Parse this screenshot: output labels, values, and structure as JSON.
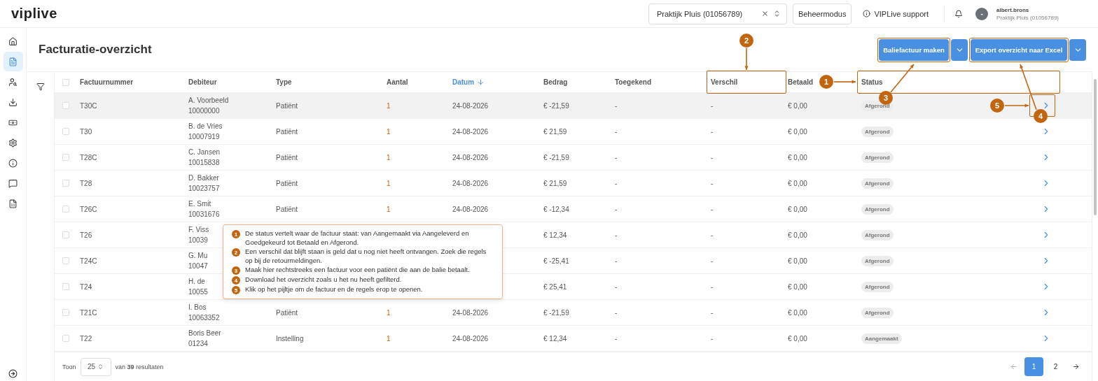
{
  "app": {
    "logo": "viplive"
  },
  "top_bar": {
    "practice_select": {
      "value": "Praktijk Pluis (01056789)"
    },
    "mode_button": "Beheermodus",
    "support_link": "VIPLive support",
    "user": {
      "avatar": "-",
      "name": "albert.brons",
      "practice": "Praktijk Pluis (01056789)"
    }
  },
  "sidebar": {
    "items": [
      {
        "selected": false
      },
      {
        "selected": true
      },
      {
        "selected": false
      },
      {
        "selected": false
      },
      {
        "selected": false
      },
      {
        "selected": false
      },
      {
        "selected": false
      },
      {
        "selected": false
      },
      {
        "selected": false
      }
    ]
  },
  "page": {
    "title": "Facturatie-overzicht",
    "buttons": [
      {
        "label": "Baliefactuur maken"
      },
      {
        "label": "Export overzicht naar Excel"
      }
    ]
  },
  "table": {
    "select_all_checked": false,
    "columns": [
      {
        "label": "Factuurnummer",
        "sorted": false
      },
      {
        "label": "Debiteur",
        "sorted": false
      },
      {
        "label": "Type",
        "sorted": false
      },
      {
        "label": "Aantal",
        "sorted": false
      },
      {
        "label": "Datum",
        "sorted": true
      },
      {
        "label": "Bedrag",
        "sorted": false
      },
      {
        "label": "Toegekend",
        "sorted": false
      },
      {
        "label": "Verschil",
        "sorted": false
      },
      {
        "label": "Betaald",
        "sorted": false
      },
      {
        "label": "Status",
        "sorted": false
      }
    ],
    "rows": [
      {
        "number": "T30C",
        "debtor": "A. Voorbeeld",
        "debtor_id": "10000000",
        "type": "Patiënt",
        "quantity": "1",
        "date": "24-08-2026",
        "amount": "€ -21,59",
        "granted": "-",
        "difference": "-",
        "paid": "€ 0,00",
        "status": "Afgerond",
        "checked": false,
        "hovered": true
      },
      {
        "number": "T30",
        "debtor": "B. de Vries",
        "debtor_id": "10007919",
        "type": "Patiënt",
        "quantity": "1",
        "date": "24-08-2026",
        "amount": "€ 21,59",
        "granted": "-",
        "difference": "-",
        "paid": "€ 0,00",
        "status": "Afgerond",
        "checked": false,
        "hovered": false
      },
      {
        "number": "T28C",
        "debtor": "C. Jansen",
        "debtor_id": "10015838",
        "type": "Patiënt",
        "quantity": "1",
        "date": "24-08-2026",
        "amount": "€ -21,59",
        "granted": "-",
        "difference": "-",
        "paid": "€ 0,00",
        "status": "Afgerond",
        "checked": false,
        "hovered": false
      },
      {
        "number": "T28",
        "debtor": "D. Bakker",
        "debtor_id": "10023757",
        "type": "Patiënt",
        "quantity": "1",
        "date": "24-08-2026",
        "amount": "€ 21,59",
        "granted": "-",
        "difference": "-",
        "paid": "€ 0,00",
        "status": "Afgerond",
        "checked": false,
        "hovered": false
      },
      {
        "number": "T26C",
        "debtor": "E. Smit",
        "debtor_id": "10031676",
        "type": "Patiënt",
        "quantity": "1",
        "date": "24-08-2026",
        "amount": "€ -12,34",
        "granted": "-",
        "difference": "-",
        "paid": "€ 0,00",
        "status": "Afgerond",
        "checked": false,
        "hovered": false
      },
      {
        "number": "T26",
        "debtor": "F. Viss",
        "debtor_id": "10039",
        "amount": "€ 12,34",
        "granted": "-",
        "difference": "-",
        "paid": "€ 0,00",
        "status": "Afgerond",
        "checked": false,
        "hovered": false
      },
      {
        "number": "T24C",
        "debtor": "G. Mu",
        "debtor_id": "10047",
        "amount": "€ -25,41",
        "granted": "-",
        "difference": "-",
        "paid": "€ 0,00",
        "status": "Afgerond",
        "checked": false,
        "hovered": false
      },
      {
        "number": "T24",
        "debtor": "H. de",
        "debtor_id": "10055",
        "amount": "€ 25,41",
        "granted": "-",
        "difference": "-",
        "paid": "€ 0,00",
        "status": "Afgerond",
        "checked": false,
        "hovered": false
      },
      {
        "number": "T21C",
        "debtor": "I. Bos",
        "debtor_id": "10063352",
        "type": "Patiënt",
        "quantity": "1",
        "date": "24-08-2026",
        "amount": "€ -21,59",
        "granted": "-",
        "difference": "-",
        "paid": "€ 0,00",
        "status": "Afgerond",
        "checked": false,
        "hovered": false
      },
      {
        "number": "T22",
        "debtor": "Boris Beer",
        "debtor_id": "01234",
        "type": "Instelling",
        "quantity": "1",
        "date": "24-08-2026",
        "amount": "€ 12,34",
        "granted": "-",
        "difference": "-",
        "paid": "€ 0,00",
        "status": "Aangemaakt",
        "checked": false,
        "hovered": false
      }
    ]
  },
  "footer": {
    "show_label": "Toon",
    "page_size": "25",
    "results": "van **39** resultaten",
    "previous": {
      "disabled": true
    },
    "next": {
      "disabled": false
    },
    "pages": [
      {
        "label": "1",
        "selected": true
      },
      {
        "label": "2",
        "selected": false
      }
    ]
  },
  "callouts": [
    {
      "number": "1"
    },
    {
      "number": "2"
    },
    {
      "number": "3"
    },
    {
      "number": "4"
    },
    {
      "number": "5"
    }
  ],
  "tooltip": {
    "notes": [
      {
        "number": "1",
        "text": "De status vertelt waar de factuur staat: van Aangemaakt via Aangeleverd en Goedgekeurd tot Betaald en Afgerond."
      },
      {
        "number": "2",
        "text": "Een verschil dat blijft staan is geld dat u nog niet heeft ontvangen. Zoek die regels op bij de retourmeldingen."
      },
      {
        "number": "3",
        "text": "Maak hier rechtstreeks een factuur voor een patiënt die aan de balie betaalt."
      },
      {
        "number": "4",
        "text": "Download het overzicht zoals u het nu heeft gefilterd."
      },
      {
        "number": "5",
        "text": "Klik op het pijltje om de factuur en de regels erop te openen."
      }
    ]
  }
}
